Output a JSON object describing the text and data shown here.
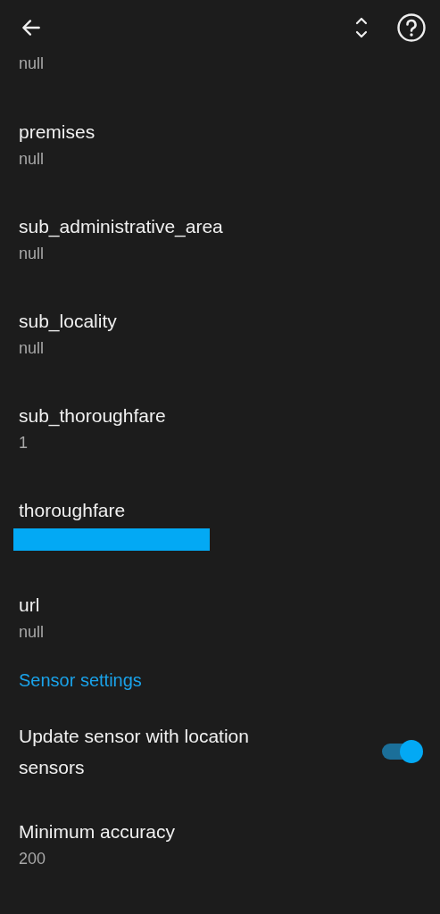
{
  "partial_value": "null",
  "items": [
    {
      "kind": "text",
      "title": "premises",
      "value": "null"
    },
    {
      "kind": "text",
      "title": "sub_administrative_area",
      "value": "null"
    },
    {
      "kind": "text",
      "title": "sub_locality",
      "value": "null"
    },
    {
      "kind": "text",
      "title": "sub_thoroughfare",
      "value": "1"
    },
    {
      "kind": "redacted",
      "title": "thoroughfare"
    },
    {
      "kind": "text",
      "title": "url",
      "value": "null"
    }
  ],
  "section": "Sensor settings",
  "settings": [
    {
      "kind": "switch",
      "title": "Update sensor with location sensors",
      "on": true
    },
    {
      "kind": "text",
      "title": "Minimum accuracy",
      "value": "200"
    }
  ]
}
